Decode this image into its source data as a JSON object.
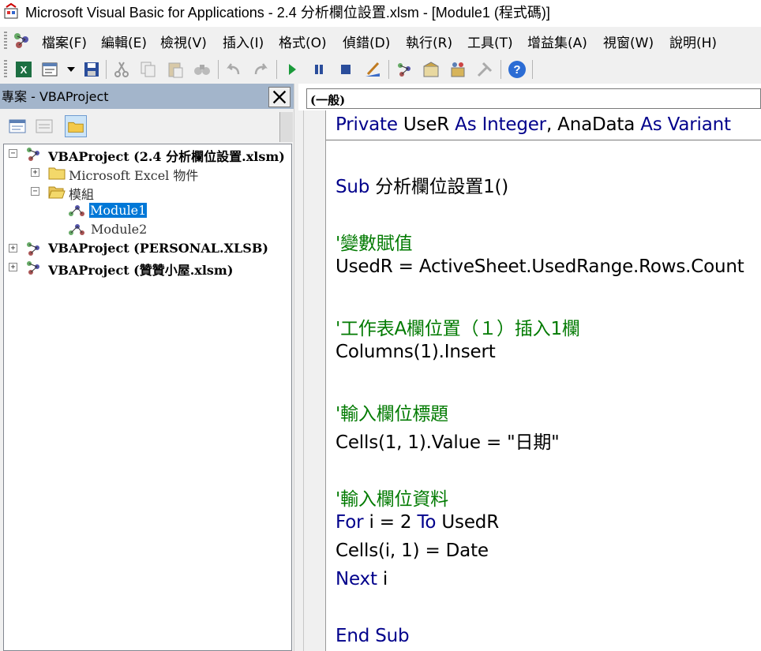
{
  "window": {
    "title": "Microsoft Visual Basic for Applications - 2.4 分析欄位設置.xlsm - [Module1 (程式碼)]"
  },
  "menu": {
    "items": [
      {
        "label": "檔案(F)"
      },
      {
        "label": "編輯(E)"
      },
      {
        "label": "檢視(V)"
      },
      {
        "label": "插入(I)"
      },
      {
        "label": "格式(O)"
      },
      {
        "label": "偵錯(D)"
      },
      {
        "label": "執行(R)"
      },
      {
        "label": "工具(T)"
      },
      {
        "label": "增益集(A)"
      },
      {
        "label": "視窗(W)"
      },
      {
        "label": "說明(H)"
      }
    ]
  },
  "toolbar": {
    "icons": [
      "excel-view-icon",
      "insert-module-icon",
      "save-icon",
      "cut-icon",
      "copy-icon",
      "paste-icon",
      "find-icon",
      "undo-icon",
      "redo-icon",
      "run-icon",
      "break-icon",
      "reset-icon",
      "design-mode-icon",
      "project-explorer-icon",
      "properties-icon",
      "object-browser-icon",
      "toolbox-icon",
      "help-icon"
    ]
  },
  "project_pane": {
    "title": "專案 - VBAProject",
    "tree": [
      {
        "label": "VBAProject (2.4 分析欄位設置.xlsm)",
        "expanded": true
      },
      {
        "label": "Microsoft Excel 物件",
        "expanded": false
      },
      {
        "label": "模組",
        "expanded": true
      },
      {
        "label": "Module1",
        "selected": true
      },
      {
        "label": "Module2"
      },
      {
        "label": "VBAProject (PERSONAL.XLSB)",
        "expanded": false
      },
      {
        "label": "VBAProject (贊贊小屋.xlsm)",
        "expanded": false
      }
    ]
  },
  "code_window": {
    "object_combo": "(一般)",
    "lines": [
      {
        "parts": [
          {
            "t": "Private ",
            "k": "kw"
          },
          {
            "t": "UseR ",
            "k": "n"
          },
          {
            "t": "As Integer",
            "k": "kw"
          },
          {
            "t": ", AnaData ",
            "k": "n"
          },
          {
            "t": "As Variant",
            "k": "kw"
          }
        ]
      },
      {
        "parts": [
          {
            "t": "Sub ",
            "k": "kw"
          },
          {
            "t": "分析欄位設置1()",
            "k": "n"
          }
        ]
      },
      {
        "parts": [
          {
            "t": "'變數賦值",
            "k": "cm"
          }
        ]
      },
      {
        "parts": [
          {
            "t": "UsedR = ActiveSheet.UsedRange.Rows.Count",
            "k": "n"
          }
        ]
      },
      {
        "parts": [
          {
            "t": "'工作表A欄位置（１）插入1欄",
            "k": "cm"
          }
        ]
      },
      {
        "parts": [
          {
            "t": "Columns(1).Insert",
            "k": "n"
          }
        ]
      },
      {
        "parts": [
          {
            "t": "'輸入欄位標題",
            "k": "cm"
          }
        ]
      },
      {
        "parts": [
          {
            "t": "Cells(1, 1).Value = \"日期\"",
            "k": "n"
          }
        ]
      },
      {
        "parts": [
          {
            "t": "'輸入欄位資料",
            "k": "cm"
          }
        ]
      },
      {
        "parts": [
          {
            "t": "For ",
            "k": "kw"
          },
          {
            "t": "i = 2 ",
            "k": "n"
          },
          {
            "t": "To ",
            "k": "kw"
          },
          {
            "t": "UsedR",
            "k": "n"
          }
        ]
      },
      {
        "parts": [
          {
            "t": "Cells(i, 1) = Date",
            "k": "n"
          }
        ]
      },
      {
        "parts": [
          {
            "t": "Next ",
            "k": "kw"
          },
          {
            "t": "i",
            "k": "n"
          }
        ]
      },
      {
        "parts": [
          {
            "t": "End Sub",
            "k": "kw"
          }
        ]
      }
    ]
  },
  "colors": {
    "keyword": "#00008b",
    "comment": "#007a00",
    "selection": "#0078d7",
    "pane_header": "#a3b5cb"
  }
}
